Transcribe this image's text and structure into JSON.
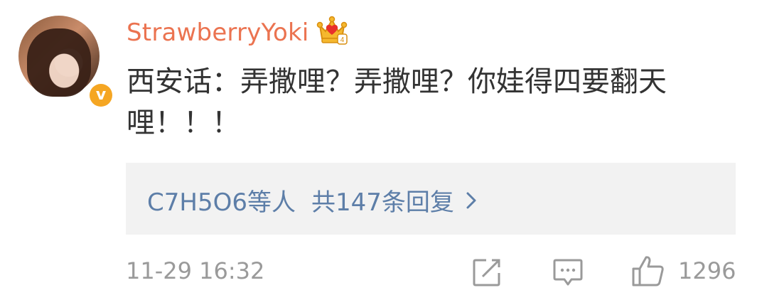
{
  "comment": {
    "username": "StrawberryYoki",
    "verified_badge": "v",
    "text": "西安话：弄撒哩？弄撒哩？你娃得四要翻天\n哩！！！",
    "replies": {
      "names": "C7H5O6等人",
      "count_label": "共147条回复"
    },
    "timestamp": "11-29 16:32",
    "like_count": "1296"
  },
  "colors": {
    "username": "#eb7350",
    "reply_link": "#5d7ea8",
    "meta_gray": "#9a9a9a",
    "badge": "#f5a623",
    "reply_bg": "#f2f2f2"
  },
  "icons": {
    "crown": "crown-icon",
    "share": "share-icon",
    "comment": "comment-icon",
    "like": "thumbs-up-icon",
    "chevron": "chevron-right-icon"
  }
}
